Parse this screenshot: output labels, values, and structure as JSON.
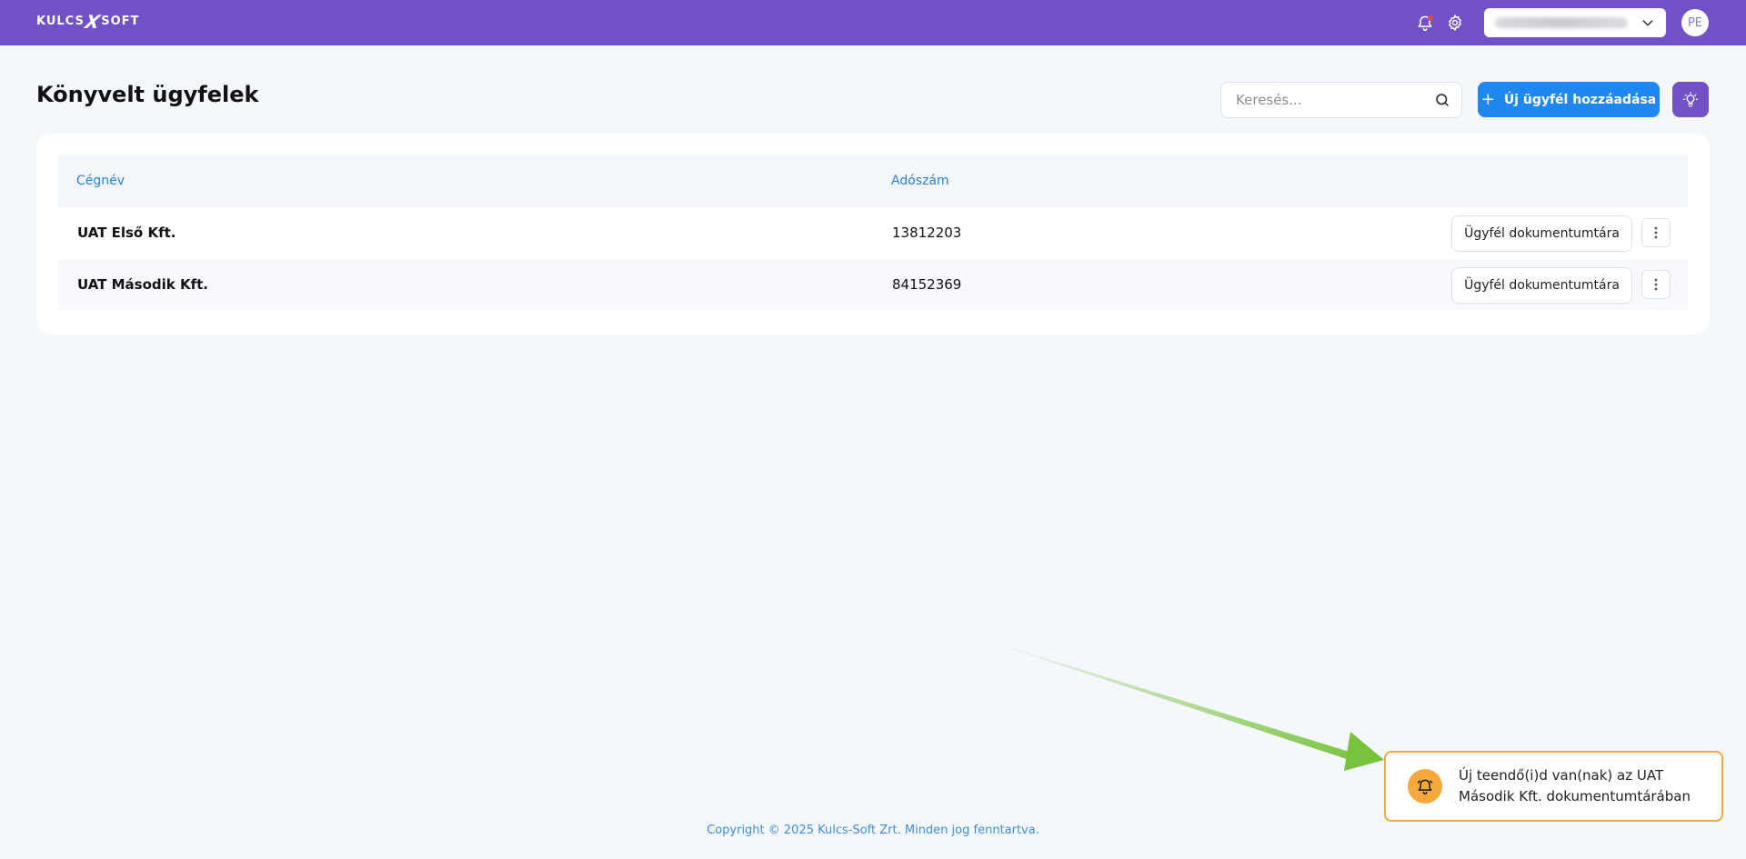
{
  "topbar": {
    "logo_left": "KULCS",
    "logo_mark": "X",
    "logo_right": "SOFT",
    "company_selected": "",
    "avatar_initials": "PE",
    "accent": "#7052c6"
  },
  "header": {
    "title": "Könyvelt ügyfelek",
    "search_placeholder": "Keresés...",
    "add_button_label": "Új ügyfél hozzáadása",
    "add_button_icon": "plus-icon",
    "idea_button_icon": "lightbulb-icon"
  },
  "table": {
    "columns": [
      "Cégnév",
      "Adószám"
    ],
    "rows": [
      {
        "name": "UAT Első Kft.",
        "tax_number": "13812203",
        "action_label": "Ügyfél dokumentumtára"
      },
      {
        "name": "UAT Második Kft.",
        "tax_number": "84152369",
        "action_label": "Ügyfél dokumentumtára"
      }
    ]
  },
  "footer": {
    "copyright": "Copyright © 2025 Kulcs-Soft Zrt. Minden jog fenntartva."
  },
  "toast": {
    "line1": "Új teendő(i)d van(nak) az UAT",
    "line2": "Második Kft. dokumentumtárában",
    "icon": "bell-icon",
    "border_color": "#f5a742"
  },
  "colors": {
    "primary_button": "#1f88f0",
    "column_header_text": "#2b7fd8",
    "page_background": "#f4f7fb",
    "annotation_arrow": "#7cc242"
  }
}
